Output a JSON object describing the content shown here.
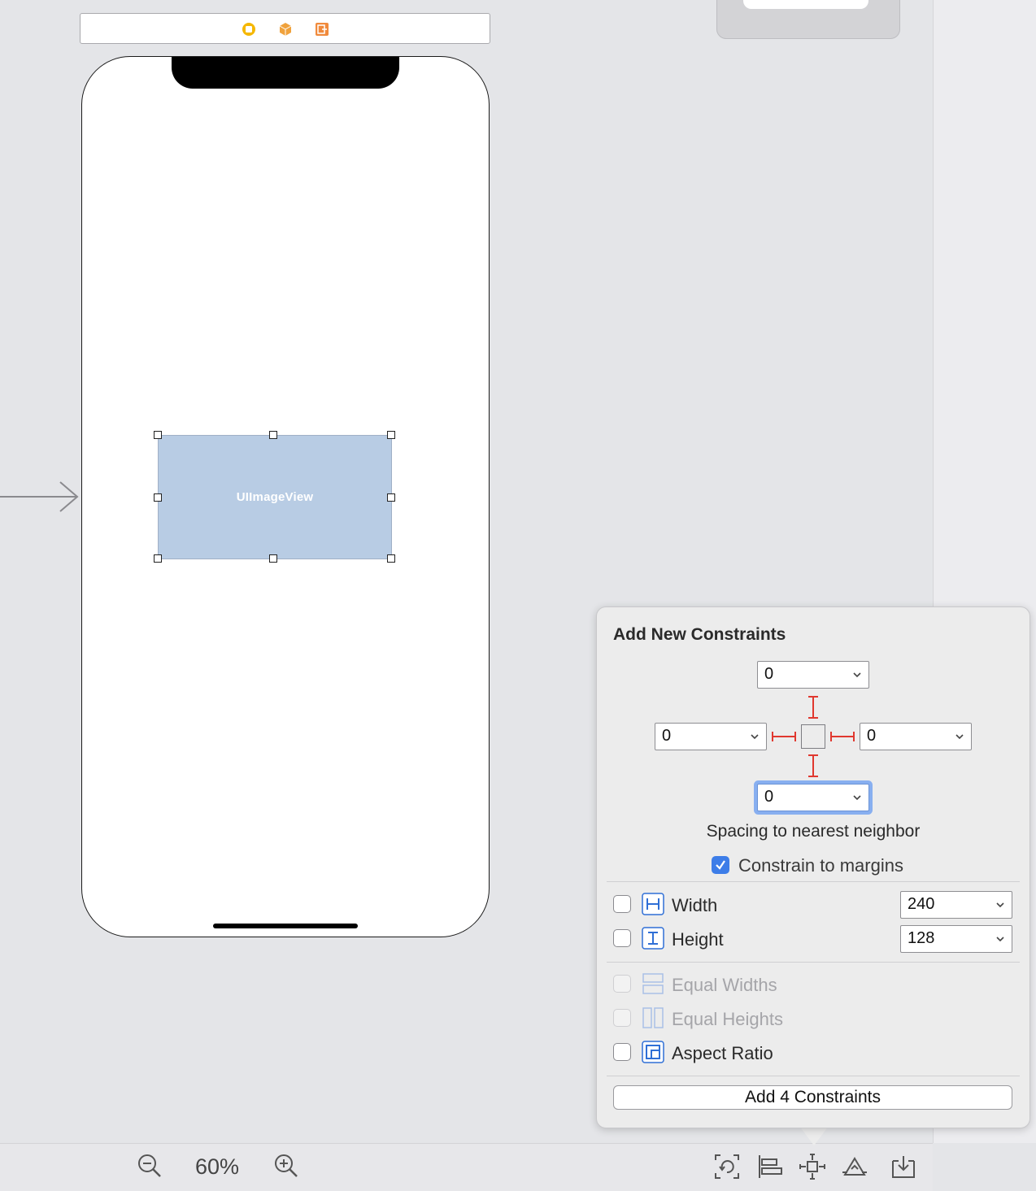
{
  "canvas": {
    "imageview_label": "UIImageView"
  },
  "bottom_bar": {
    "zoom_level": "60%"
  },
  "constraints_popover": {
    "title": "Add New Constraints",
    "spacing": {
      "top": "0",
      "left": "0",
      "right": "0",
      "bottom": "0"
    },
    "spacing_caption": "Spacing to nearest neighbor",
    "constrain_to_margins": {
      "label": "Constrain to margins",
      "checked": true
    },
    "width": {
      "label": "Width",
      "value": "240",
      "checked": false
    },
    "height": {
      "label": "Height",
      "value": "128",
      "checked": false
    },
    "equal_widths": {
      "label": "Equal Widths",
      "enabled": false
    },
    "equal_heights": {
      "label": "Equal Heights",
      "enabled": false
    },
    "aspect_ratio": {
      "label": "Aspect Ratio",
      "checked": false
    },
    "add_button_label": "Add 4 Constraints"
  },
  "colors": {
    "constraint_red": "#e0382f",
    "checkbox_blue": "#3d7de8",
    "focus_ring": "#88aff0",
    "imageview_fill": "#b8cce4"
  }
}
